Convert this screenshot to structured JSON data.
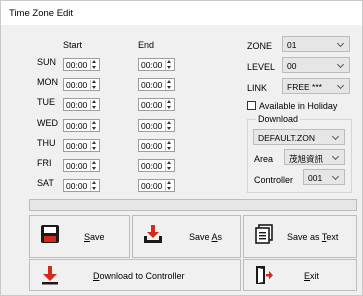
{
  "window": {
    "title": "Time Zone Edit"
  },
  "schedule": {
    "start_header": "Start",
    "end_header": "End",
    "days": [
      {
        "day": "SUN",
        "start": "00:00",
        "end": "00:00"
      },
      {
        "day": "MON",
        "start": "00:00",
        "end": "00:00"
      },
      {
        "day": "TUE",
        "start": "00:00",
        "end": "00:00"
      },
      {
        "day": "WED",
        "start": "00:00",
        "end": "00:00"
      },
      {
        "day": "THU",
        "start": "00:00",
        "end": "00:00"
      },
      {
        "day": "FRI",
        "start": "00:00",
        "end": "00:00"
      },
      {
        "day": "SAT",
        "start": "00:00",
        "end": "00:00"
      }
    ]
  },
  "settings": {
    "zone_label": "ZONE",
    "zone_value": "01",
    "level_label": "LEVEL",
    "level_value": "00",
    "link_label": "LINK",
    "link_value": "FREE ***",
    "holiday_label": "Available in Holiday",
    "holiday_checked": false
  },
  "download": {
    "group_title": "Download",
    "file_value": "DEFAULT.ZON",
    "area_label": "Area",
    "area_value": "茂旭資訊",
    "controller_label": "Controller",
    "controller_value": "001"
  },
  "progress": {
    "value": 0
  },
  "buttons": {
    "save": {
      "mn": "S",
      "rest": "ave"
    },
    "save_as": {
      "pre": "Save ",
      "mn": "A",
      "rest": "s"
    },
    "save_as_text": {
      "pre": "Save as ",
      "mn": "T",
      "rest": "ext"
    },
    "download": {
      "mn": "D",
      "rest": "ownload to Controller"
    },
    "exit": {
      "mn": "E",
      "rest": "xit"
    }
  },
  "colors": {
    "accent_red": "#d42a1a",
    "icon_dark": "#1a1a1a"
  }
}
